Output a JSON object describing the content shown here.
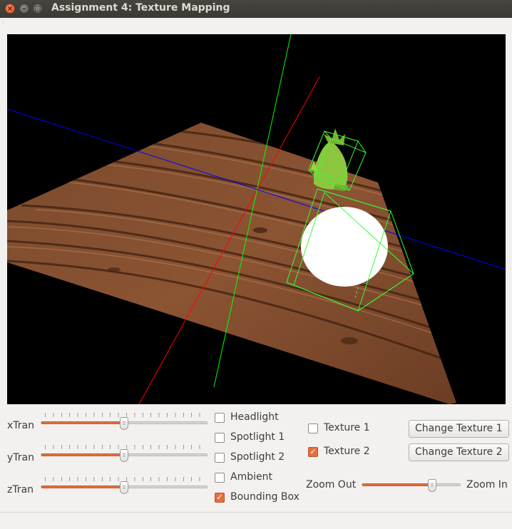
{
  "window": {
    "title": "Assignment 4: Texture Mapping"
  },
  "controls": {
    "sliders": [
      {
        "label": "xTran",
        "level": 0.5
      },
      {
        "label": "yTran",
        "level": 0.5
      },
      {
        "label": "zTran",
        "level": 0.5
      }
    ],
    "checkboxes": [
      {
        "label": "Headlight",
        "checked": false
      },
      {
        "label": "Spotlight 1",
        "checked": false
      },
      {
        "label": "Spotlight 2",
        "checked": false
      },
      {
        "label": "Ambient",
        "checked": false
      },
      {
        "label": "Bounding Box",
        "checked": true
      }
    ],
    "textures": [
      {
        "label": "Texture 1",
        "checked": false
      },
      {
        "label": "Texture 2",
        "checked": true
      }
    ],
    "change_texture_1": "Change Texture 1",
    "change_texture_2": "Change Texture 2",
    "zoom_out": "Zoom Out",
    "zoom_in": "Zoom In",
    "zoom_level": 0.71
  },
  "colors": {
    "accent": "#e4703e",
    "axis_x": "#ff0000",
    "axis_y": "#00ff00",
    "axis_z": "#0000ff"
  }
}
